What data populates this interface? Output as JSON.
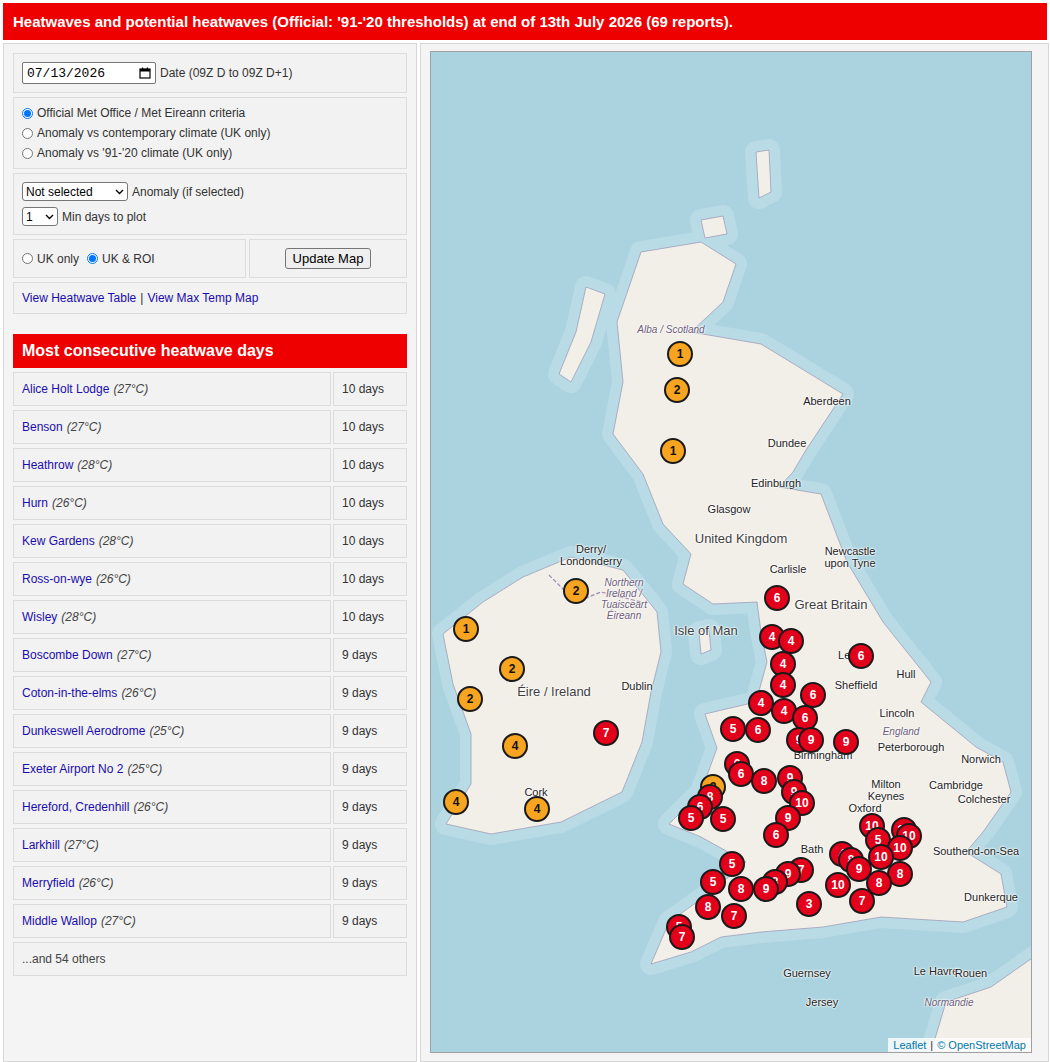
{
  "header": {
    "title": "Heatwaves and potential heatwaves (Official: '91-'20 thresholds) at end of 13th July 2026 (69 reports)."
  },
  "date": {
    "value": "07/13/2026",
    "label": "Date (09Z D to 09Z D+1)"
  },
  "criteria": [
    {
      "label": "Official Met Office / Met Eireann criteria",
      "selected": true
    },
    {
      "label": "Anomaly vs contemporary climate (UK only)",
      "selected": false
    },
    {
      "label": "Anomaly vs '91-'20 climate (UK only)",
      "selected": false
    }
  ],
  "anomaly_select": {
    "value": "Not selected",
    "label": "Anomaly (if selected)"
  },
  "min_days_select": {
    "value": "1",
    "label": "Min days to plot"
  },
  "region": [
    {
      "label": "UK only",
      "selected": false
    },
    {
      "label": "UK & ROI",
      "selected": true
    }
  ],
  "update_button": "Update Map",
  "links": {
    "table": "View Heatwave Table",
    "separator": "|",
    "max_temp": "View Max Temp Map"
  },
  "table": {
    "title": "Most consecutive heatwave days",
    "rows": [
      {
        "name": "Alice Holt Lodge",
        "threshold": "(27°C)",
        "days": "10 days"
      },
      {
        "name": "Benson",
        "threshold": "(27°C)",
        "days": "10 days"
      },
      {
        "name": "Heathrow",
        "threshold": "(28°C)",
        "days": "10 days"
      },
      {
        "name": "Hurn",
        "threshold": "(26°C)",
        "days": "10 days"
      },
      {
        "name": "Kew Gardens",
        "threshold": "(28°C)",
        "days": "10 days"
      },
      {
        "name": "Ross-on-wye",
        "threshold": "(26°C)",
        "days": "10 days"
      },
      {
        "name": "Wisley",
        "threshold": "(28°C)",
        "days": "10 days"
      },
      {
        "name": "Boscombe Down",
        "threshold": "(27°C)",
        "days": "9 days"
      },
      {
        "name": "Coton-in-the-elms",
        "threshold": "(26°C)",
        "days": "9 days"
      },
      {
        "name": "Dunkeswell Aerodrome",
        "threshold": "(25°C)",
        "days": "9 days"
      },
      {
        "name": "Exeter Airport No 2",
        "threshold": "(25°C)",
        "days": "9 days"
      },
      {
        "name": "Hereford, Credenhill",
        "threshold": "(26°C)",
        "days": "9 days"
      },
      {
        "name": "Larkhill",
        "threshold": "(27°C)",
        "days": "9 days"
      },
      {
        "name": "Merryfield",
        "threshold": "(26°C)",
        "days": "9 days"
      },
      {
        "name": "Middle Wallop",
        "threshold": "(27°C)",
        "days": "9 days"
      }
    ],
    "footer": "...and 54 others"
  },
  "map": {
    "labels": [
      {
        "text": "Alba / Scotland",
        "kind": "region"
      },
      {
        "text": "Aberdeen",
        "kind": "city"
      },
      {
        "text": "Dundee",
        "kind": "city"
      },
      {
        "text": "Edinburgh",
        "kind": "city"
      },
      {
        "text": "Glasgow",
        "kind": "city"
      },
      {
        "text": "United Kingdom",
        "kind": "country"
      },
      {
        "text": "Newcastle upon Tyne",
        "kind": "city"
      },
      {
        "text": "Carlisle",
        "kind": "city"
      },
      {
        "text": "Derry/ Londonderry",
        "kind": "city"
      },
      {
        "text": "Northern Ireland / Tuaisceart Éireann",
        "kind": "region"
      },
      {
        "text": "Great Britain",
        "kind": "country"
      },
      {
        "text": "Isle of Man",
        "kind": "country"
      },
      {
        "text": "Leeds",
        "kind": "city"
      },
      {
        "text": "Sheffield",
        "kind": "city"
      },
      {
        "text": "Hull",
        "kind": "city"
      },
      {
        "text": "Lincoln",
        "kind": "city"
      },
      {
        "text": "England",
        "kind": "region"
      },
      {
        "text": "Éire / Ireland",
        "kind": "country"
      },
      {
        "text": "Dublin",
        "kind": "city"
      },
      {
        "text": "Norwich",
        "kind": "city"
      },
      {
        "text": "Peterborough",
        "kind": "city"
      },
      {
        "text": "Birmingham",
        "kind": "city"
      },
      {
        "text": "Milton Keynes",
        "kind": "city"
      },
      {
        "text": "Cambridge",
        "kind": "city"
      },
      {
        "text": "Colchester",
        "kind": "city"
      },
      {
        "text": "Oxford",
        "kind": "city"
      },
      {
        "text": "Bath",
        "kind": "city"
      },
      {
        "text": "Southend-on-Sea",
        "kind": "city"
      },
      {
        "text": "Dunkerque",
        "kind": "city"
      },
      {
        "text": "Cork",
        "kind": "city"
      },
      {
        "text": "Guernsey",
        "kind": "city"
      },
      {
        "text": "Jersey",
        "kind": "city"
      },
      {
        "text": "Le Havre",
        "kind": "city"
      },
      {
        "text": "Rouen",
        "kind": "city"
      },
      {
        "text": "Normandie",
        "kind": "region"
      }
    ],
    "pins": [
      {
        "label": "1",
        "color": "#f7a520"
      },
      {
        "label": "2",
        "color": "#f7a520"
      },
      {
        "label": "1",
        "color": "#f7a520"
      },
      {
        "label": "2",
        "color": "#f7a520"
      },
      {
        "label": "1",
        "color": "#f7a520"
      },
      {
        "label": "2",
        "color": "#f7a520"
      },
      {
        "label": "2",
        "color": "#f7a520"
      },
      {
        "label": "4",
        "color": "#f7a520"
      },
      {
        "label": "4",
        "color": "#f7a520"
      },
      {
        "label": "4",
        "color": "#f7a520"
      },
      {
        "label": "2",
        "color": "#f7a520"
      },
      {
        "label": "6",
        "color": "#e3001b"
      },
      {
        "label": "4",
        "color": "#e3001b"
      },
      {
        "label": "4",
        "color": "#e3001b"
      },
      {
        "label": "4",
        "color": "#e3001b"
      },
      {
        "label": "6",
        "color": "#e3001b"
      },
      {
        "label": "4",
        "color": "#e3001b"
      },
      {
        "label": "6",
        "color": "#e3001b"
      },
      {
        "label": "4",
        "color": "#e3001b"
      },
      {
        "label": "4",
        "color": "#e3001b"
      },
      {
        "label": "6",
        "color": "#e3001b"
      },
      {
        "label": "5",
        "color": "#e3001b"
      },
      {
        "label": "6",
        "color": "#e3001b"
      },
      {
        "label": "7",
        "color": "#e3001b"
      },
      {
        "label": "9",
        "color": "#e3001b"
      },
      {
        "label": "9",
        "color": "#e3001b"
      },
      {
        "label": "9",
        "color": "#e3001b"
      },
      {
        "label": "6",
        "color": "#e3001b"
      },
      {
        "label": "6",
        "color": "#e3001b"
      },
      {
        "label": "8",
        "color": "#e3001b"
      },
      {
        "label": "9",
        "color": "#e3001b"
      },
      {
        "label": "9",
        "color": "#e3001b"
      },
      {
        "label": "8",
        "color": "#e3001b"
      },
      {
        "label": "6",
        "color": "#e3001b"
      },
      {
        "label": "10",
        "color": "#e3001b"
      },
      {
        "label": "5",
        "color": "#e3001b"
      },
      {
        "label": "5",
        "color": "#e3001b"
      },
      {
        "label": "9",
        "color": "#e3001b"
      },
      {
        "label": "6",
        "color": "#e3001b"
      },
      {
        "label": "10",
        "color": "#e3001b"
      },
      {
        "label": "10",
        "color": "#e3001b"
      },
      {
        "label": "10",
        "color": "#e3001b"
      },
      {
        "label": "5",
        "color": "#e3001b"
      },
      {
        "label": "10",
        "color": "#e3001b"
      },
      {
        "label": "4",
        "color": "#e3001b"
      },
      {
        "label": "8",
        "color": "#e3001b"
      },
      {
        "label": "10",
        "color": "#e3001b"
      },
      {
        "label": "9",
        "color": "#e3001b"
      },
      {
        "label": "5",
        "color": "#e3001b"
      },
      {
        "label": "5",
        "color": "#e3001b"
      },
      {
        "label": "7",
        "color": "#e3001b"
      },
      {
        "label": "9",
        "color": "#e3001b"
      },
      {
        "label": "8",
        "color": "#e3001b"
      },
      {
        "label": "8",
        "color": "#e3001b"
      },
      {
        "label": "9",
        "color": "#e3001b"
      },
      {
        "label": "8",
        "color": "#e3001b"
      },
      {
        "label": "8",
        "color": "#e3001b"
      },
      {
        "label": "10",
        "color": "#e3001b"
      },
      {
        "label": "8",
        "color": "#e3001b"
      },
      {
        "label": "7",
        "color": "#e3001b"
      },
      {
        "label": "3",
        "color": "#e3001b"
      },
      {
        "label": "7",
        "color": "#e3001b"
      },
      {
        "label": "5",
        "color": "#e3001b"
      },
      {
        "label": "7",
        "color": "#e3001b"
      }
    ],
    "attribution": {
      "leaflet": "Leaflet",
      "separator": "|",
      "osm": "© OpenStreetMap"
    }
  }
}
